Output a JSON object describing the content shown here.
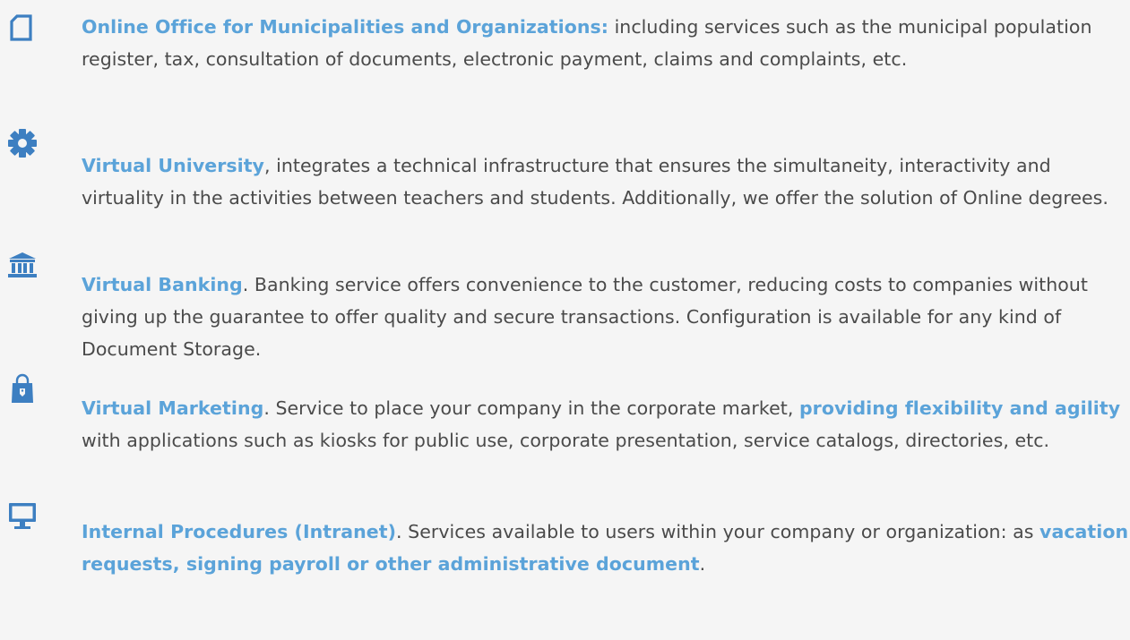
{
  "colors": {
    "background": "#f5f5f5",
    "body_text": "#4a4a4a",
    "highlight": "#5ba3d9",
    "icon": "#3d7fc1"
  },
  "items": [
    {
      "icon": "document-icon",
      "title": "Online Office for Municipalities and Organizations:",
      "text": " including services such as the municipal population register, tax, consultation of documents, electronic payment, claims and complaints, etc."
    },
    {
      "icon": "gear-icon",
      "title": "Virtual University",
      "text": ", integrates a technical infrastructure that ensures the simultaneity, interactivity and virtuality in the activities between teachers and students. Additionally, we offer the solution of Online degrees."
    },
    {
      "icon": "bank-icon",
      "title": "Virtual Banking",
      "text": ". Banking service offers convenience to the customer, reducing costs to companies without giving up the guarantee to offer quality and secure transactions. Configuration is available for any kind of Document Storage."
    },
    {
      "icon": "shopping-bag-icon",
      "title": "Virtual Marketing",
      "text": ". Service to place your company in the corporate market, ",
      "highlight": "providing flexibility and agility",
      "text2": " with applications such as kiosks for public use, corporate presentation, service catalogs, directories, etc."
    },
    {
      "icon": "desktop-icon",
      "title": " Internal Procedures (Intranet)",
      "text": ". Services available to users within your company or organization: as ",
      "highlight": "vacation requests, signing payroll or other administrative document",
      "text2": "."
    }
  ]
}
